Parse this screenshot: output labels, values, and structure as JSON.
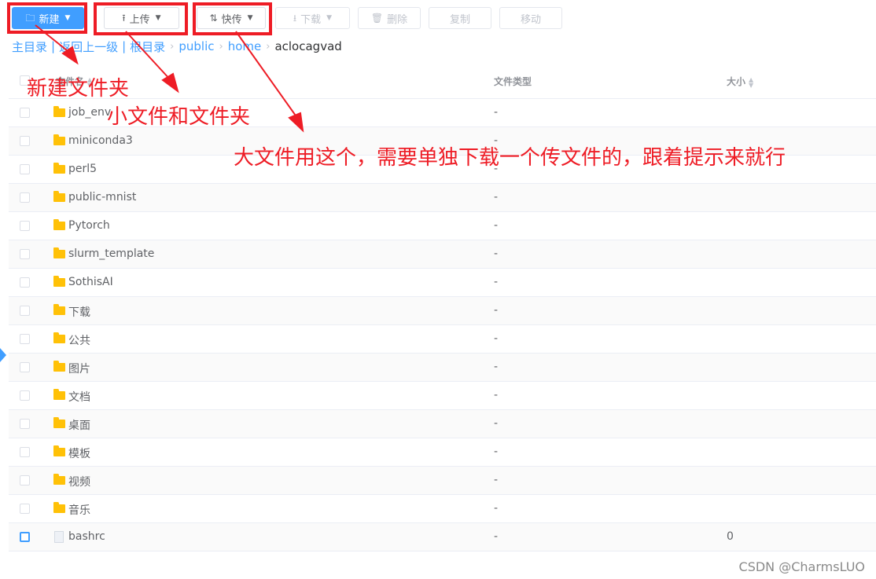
{
  "toolbar": {
    "new_label": "新建",
    "upload_label": "上传",
    "fast_transfer_label": "快传",
    "download_label": "下载",
    "delete_label": "删除",
    "copy_label": "复制",
    "move_label": "移动"
  },
  "breadcrumb": {
    "home": "主目录",
    "back": "返回上一级",
    "root": "根目录",
    "sep": "|",
    "path": [
      "public",
      "home"
    ],
    "current": "aclocagvad"
  },
  "table": {
    "headers": {
      "name": "文件名",
      "type": "文件类型",
      "size": "大小"
    },
    "rows": [
      {
        "name": "job_env",
        "type": "-",
        "size": "",
        "kind": "folder"
      },
      {
        "name": "miniconda3",
        "type": "-",
        "size": "",
        "kind": "folder"
      },
      {
        "name": "perl5",
        "type": "-",
        "size": "",
        "kind": "folder"
      },
      {
        "name": "public-mnist",
        "type": "-",
        "size": "",
        "kind": "folder"
      },
      {
        "name": "Pytorch",
        "type": "-",
        "size": "",
        "kind": "folder"
      },
      {
        "name": "slurm_template",
        "type": "-",
        "size": "",
        "kind": "folder"
      },
      {
        "name": "SothisAI",
        "type": "-",
        "size": "",
        "kind": "folder"
      },
      {
        "name": "下载",
        "type": "-",
        "size": "",
        "kind": "folder"
      },
      {
        "name": "公共",
        "type": "-",
        "size": "",
        "kind": "folder"
      },
      {
        "name": "图片",
        "type": "-",
        "size": "",
        "kind": "folder"
      },
      {
        "name": "文档",
        "type": "-",
        "size": "",
        "kind": "folder"
      },
      {
        "name": "桌面",
        "type": "-",
        "size": "",
        "kind": "folder"
      },
      {
        "name": "模板",
        "type": "-",
        "size": "",
        "kind": "folder"
      },
      {
        "name": "视频",
        "type": "-",
        "size": "",
        "kind": "folder"
      },
      {
        "name": "音乐",
        "type": "-",
        "size": "",
        "kind": "folder"
      },
      {
        "name": "bashrc",
        "type": "-",
        "size": "0",
        "kind": "file"
      }
    ]
  },
  "annotations": {
    "new_folder": "新建文件夹",
    "small_files": "小文件和文件夹",
    "big_files": "大文件用这个，需要单独下载一个传文件的，跟着提示来就行"
  },
  "watermark": "CSDN @CharmsLUO",
  "colors": {
    "accent": "#409eff",
    "annotation": "#ee1c25",
    "folder": "#ffc107"
  }
}
